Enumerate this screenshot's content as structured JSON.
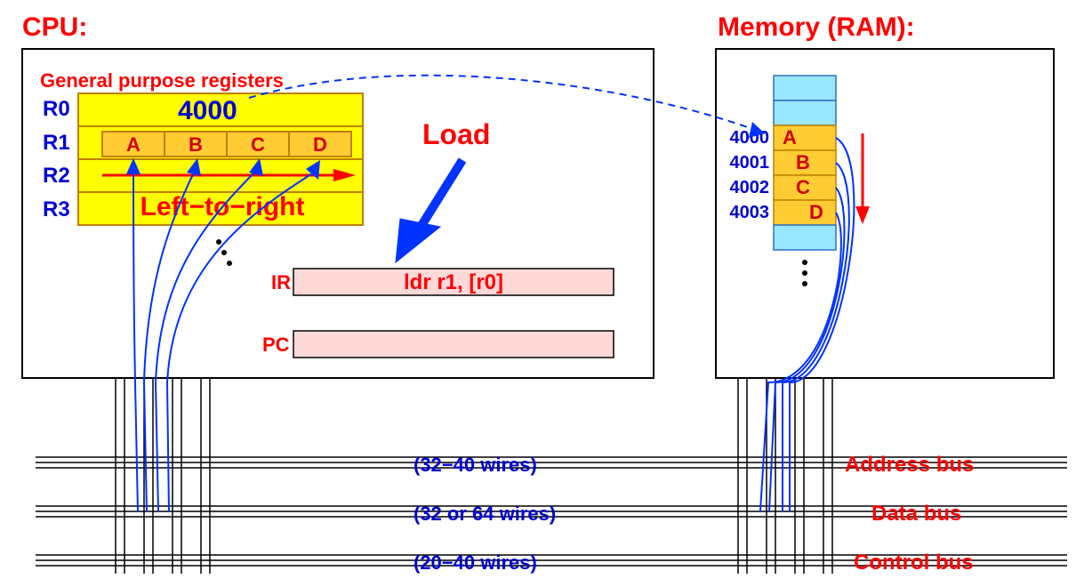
{
  "titles": {
    "cpu": "CPU:",
    "memory": "Memory (RAM):"
  },
  "regs_header": "General purpose registers",
  "registers": [
    "R0",
    "R1",
    "R2",
    "R3"
  ],
  "r0_value": "4000",
  "r1_bytes": [
    "A",
    "B",
    "C",
    "D"
  ],
  "left_to_right": "Left−to−right",
  "load_label": "Load",
  "ir": {
    "label": "IR",
    "value": "ldr  r1, [r0]"
  },
  "pc": {
    "label": "PC",
    "value": ""
  },
  "memory": {
    "addresses": [
      "4000",
      "4001",
      "4002",
      "4003"
    ],
    "bytes": [
      "A",
      "B",
      "C",
      "D"
    ]
  },
  "buses": {
    "address": {
      "label": "Address bus",
      "wires": "(32−40 wires)"
    },
    "data": {
      "label": "Data bus",
      "wires": "(32 or 64 wires)"
    },
    "control": {
      "label": "Control bus",
      "wires": "(20−40 wires)"
    }
  }
}
